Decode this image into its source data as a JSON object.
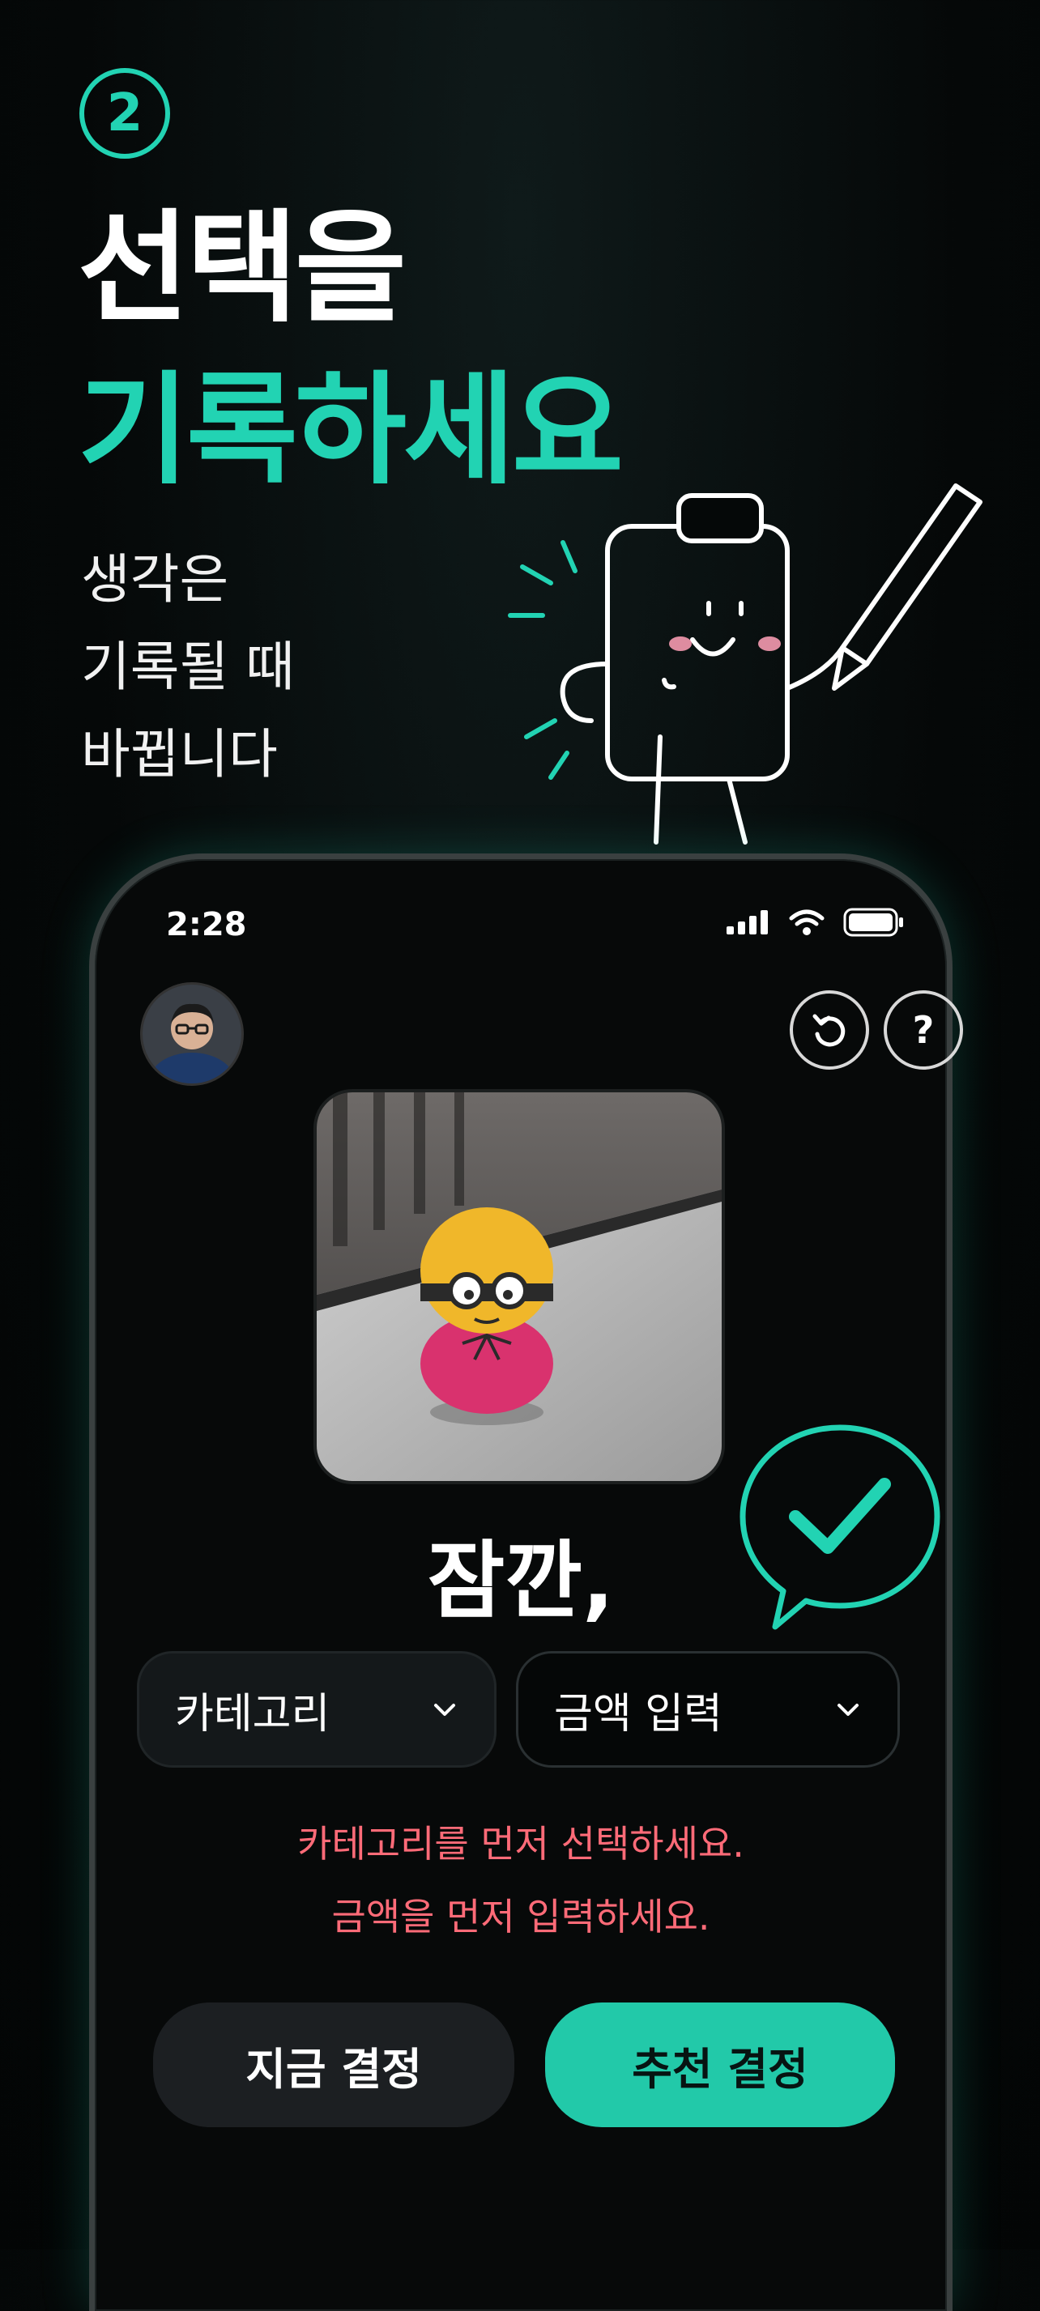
{
  "step": {
    "number": "2"
  },
  "headline": {
    "line1": "선택을",
    "line2": "기록하세요"
  },
  "subtitle": {
    "lines": [
      "생각은",
      "기록될 때",
      "바뀝니다"
    ]
  },
  "mascot": {
    "icon": "clipboard-mascot-with-pen"
  },
  "status_bar": {
    "time": "2:28",
    "icons": [
      "signal-icon",
      "wifi-icon",
      "battery-icon"
    ]
  },
  "header": {
    "avatar": "user-avatar",
    "buttons": [
      "undo-icon",
      "help-icon"
    ],
    "help_glyph": "?"
  },
  "photo": {
    "subject": "roly-poly doll with glasses"
  },
  "title": "잠깐,",
  "badge": {
    "icon": "checkmark-speech-bubble-icon"
  },
  "selects": {
    "category": {
      "label": "카테고리"
    },
    "amount": {
      "label": "금액 입력"
    }
  },
  "errors": [
    "카테고리를 먼저 선택하세요.",
    "금액을 먼저 입력하세요."
  ],
  "actions": {
    "decide_now": "지금 결정",
    "recommend": "추천 결정"
  },
  "colors": {
    "accent": "#22d3b3",
    "error": "#ff6b78",
    "background": "#050808",
    "button_primary": "#22c9a9"
  }
}
